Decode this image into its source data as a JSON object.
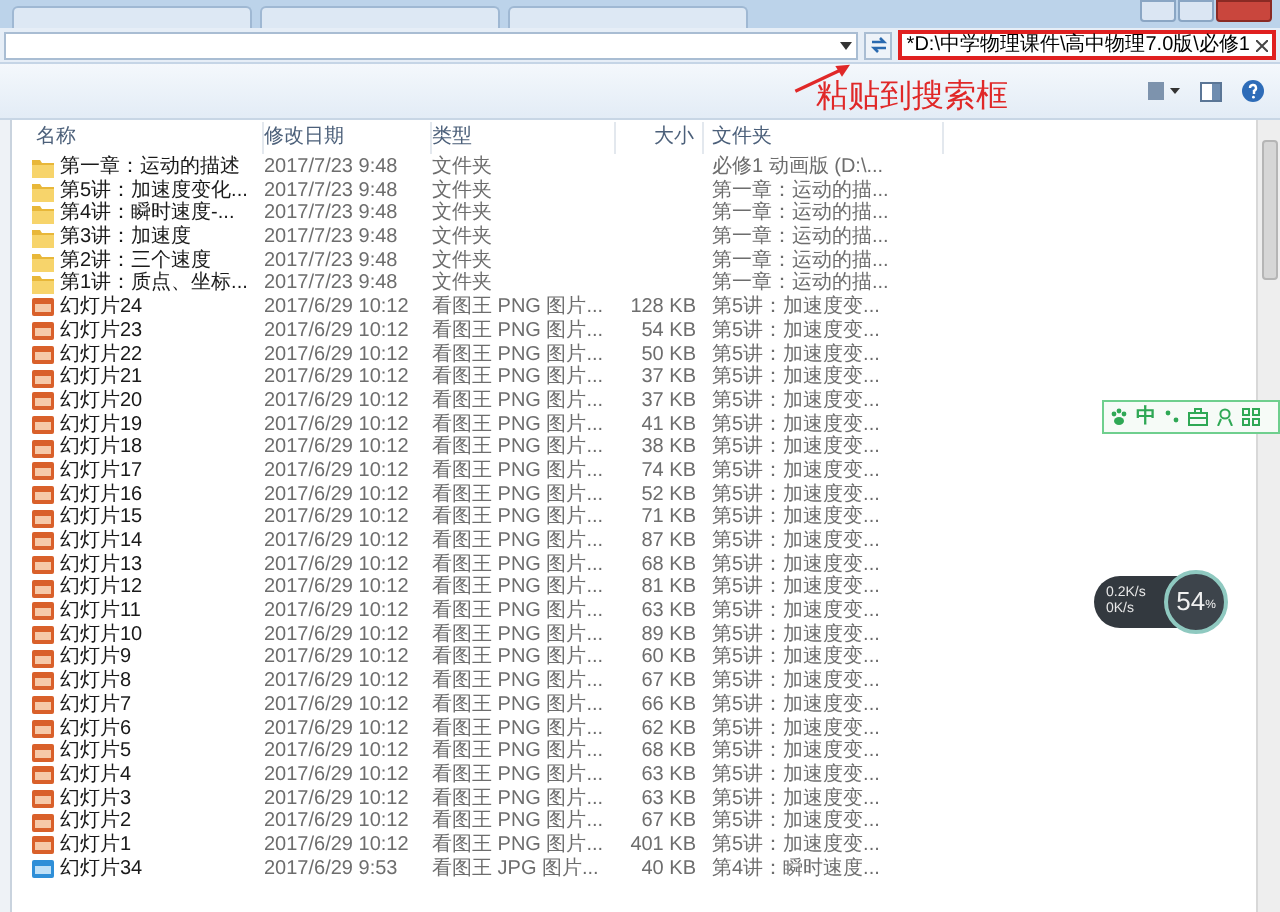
{
  "search": {
    "value": "*D:\\中学物理课件\\高中物理7.0版\\必修1"
  },
  "annotation": {
    "text": "粘贴到搜索框"
  },
  "columns": [
    "名称",
    "修改日期",
    "类型",
    "大小",
    "文件夹"
  ],
  "rows": [
    {
      "kind": "folder",
      "name": "第一章：运动的描述",
      "date": "2017/7/23 9:48",
      "type": "文件夹",
      "size": "",
      "folder": "必修1 动画版 (D:\\..."
    },
    {
      "kind": "folder",
      "name": "第5讲：加速度变化...",
      "date": "2017/7/23 9:48",
      "type": "文件夹",
      "size": "",
      "folder": "第一章：运动的描..."
    },
    {
      "kind": "folder",
      "name": "第4讲：瞬时速度-...",
      "date": "2017/7/23 9:48",
      "type": "文件夹",
      "size": "",
      "folder": "第一章：运动的描..."
    },
    {
      "kind": "folder",
      "name": "第3讲：加速度",
      "date": "2017/7/23 9:48",
      "type": "文件夹",
      "size": "",
      "folder": "第一章：运动的描..."
    },
    {
      "kind": "folder",
      "name": "第2讲：三个速度",
      "date": "2017/7/23 9:48",
      "type": "文件夹",
      "size": "",
      "folder": "第一章：运动的描..."
    },
    {
      "kind": "folder",
      "name": "第1讲：质点、坐标...",
      "date": "2017/7/23 9:48",
      "type": "文件夹",
      "size": "",
      "folder": "第一章：运动的描..."
    },
    {
      "kind": "png",
      "name": "幻灯片24",
      "date": "2017/6/29 10:12",
      "type": "看图王 PNG 图片...",
      "size": "128 KB",
      "folder": "第5讲：加速度变..."
    },
    {
      "kind": "png",
      "name": "幻灯片23",
      "date": "2017/6/29 10:12",
      "type": "看图王 PNG 图片...",
      "size": "54 KB",
      "folder": "第5讲：加速度变..."
    },
    {
      "kind": "png",
      "name": "幻灯片22",
      "date": "2017/6/29 10:12",
      "type": "看图王 PNG 图片...",
      "size": "50 KB",
      "folder": "第5讲：加速度变..."
    },
    {
      "kind": "png",
      "name": "幻灯片21",
      "date": "2017/6/29 10:12",
      "type": "看图王 PNG 图片...",
      "size": "37 KB",
      "folder": "第5讲：加速度变..."
    },
    {
      "kind": "png",
      "name": "幻灯片20",
      "date": "2017/6/29 10:12",
      "type": "看图王 PNG 图片...",
      "size": "37 KB",
      "folder": "第5讲：加速度变..."
    },
    {
      "kind": "png",
      "name": "幻灯片19",
      "date": "2017/6/29 10:12",
      "type": "看图王 PNG 图片...",
      "size": "41 KB",
      "folder": "第5讲：加速度变..."
    },
    {
      "kind": "png",
      "name": "幻灯片18",
      "date": "2017/6/29 10:12",
      "type": "看图王 PNG 图片...",
      "size": "38 KB",
      "folder": "第5讲：加速度变..."
    },
    {
      "kind": "png",
      "name": "幻灯片17",
      "date": "2017/6/29 10:12",
      "type": "看图王 PNG 图片...",
      "size": "74 KB",
      "folder": "第5讲：加速度变..."
    },
    {
      "kind": "png",
      "name": "幻灯片16",
      "date": "2017/6/29 10:12",
      "type": "看图王 PNG 图片...",
      "size": "52 KB",
      "folder": "第5讲：加速度变..."
    },
    {
      "kind": "png",
      "name": "幻灯片15",
      "date": "2017/6/29 10:12",
      "type": "看图王 PNG 图片...",
      "size": "71 KB",
      "folder": "第5讲：加速度变..."
    },
    {
      "kind": "png",
      "name": "幻灯片14",
      "date": "2017/6/29 10:12",
      "type": "看图王 PNG 图片...",
      "size": "87 KB",
      "folder": "第5讲：加速度变..."
    },
    {
      "kind": "png",
      "name": "幻灯片13",
      "date": "2017/6/29 10:12",
      "type": "看图王 PNG 图片...",
      "size": "68 KB",
      "folder": "第5讲：加速度变..."
    },
    {
      "kind": "png",
      "name": "幻灯片12",
      "date": "2017/6/29 10:12",
      "type": "看图王 PNG 图片...",
      "size": "81 KB",
      "folder": "第5讲：加速度变..."
    },
    {
      "kind": "png",
      "name": "幻灯片11",
      "date": "2017/6/29 10:12",
      "type": "看图王 PNG 图片...",
      "size": "63 KB",
      "folder": "第5讲：加速度变..."
    },
    {
      "kind": "png",
      "name": "幻灯片10",
      "date": "2017/6/29 10:12",
      "type": "看图王 PNG 图片...",
      "size": "89 KB",
      "folder": "第5讲：加速度变..."
    },
    {
      "kind": "png",
      "name": "幻灯片9",
      "date": "2017/6/29 10:12",
      "type": "看图王 PNG 图片...",
      "size": "60 KB",
      "folder": "第5讲：加速度变..."
    },
    {
      "kind": "png",
      "name": "幻灯片8",
      "date": "2017/6/29 10:12",
      "type": "看图王 PNG 图片...",
      "size": "67 KB",
      "folder": "第5讲：加速度变..."
    },
    {
      "kind": "png",
      "name": "幻灯片7",
      "date": "2017/6/29 10:12",
      "type": "看图王 PNG 图片...",
      "size": "66 KB",
      "folder": "第5讲：加速度变..."
    },
    {
      "kind": "png",
      "name": "幻灯片6",
      "date": "2017/6/29 10:12",
      "type": "看图王 PNG 图片...",
      "size": "62 KB",
      "folder": "第5讲：加速度变..."
    },
    {
      "kind": "png",
      "name": "幻灯片5",
      "date": "2017/6/29 10:12",
      "type": "看图王 PNG 图片...",
      "size": "68 KB",
      "folder": "第5讲：加速度变..."
    },
    {
      "kind": "png",
      "name": "幻灯片4",
      "date": "2017/6/29 10:12",
      "type": "看图王 PNG 图片...",
      "size": "63 KB",
      "folder": "第5讲：加速度变..."
    },
    {
      "kind": "png",
      "name": "幻灯片3",
      "date": "2017/6/29 10:12",
      "type": "看图王 PNG 图片...",
      "size": "63 KB",
      "folder": "第5讲：加速度变..."
    },
    {
      "kind": "png",
      "name": "幻灯片2",
      "date": "2017/6/29 10:12",
      "type": "看图王 PNG 图片...",
      "size": "67 KB",
      "folder": "第5讲：加速度变..."
    },
    {
      "kind": "png",
      "name": "幻灯片1",
      "date": "2017/6/29 10:12",
      "type": "看图王 PNG 图片...",
      "size": "401 KB",
      "folder": "第5讲：加速度变..."
    },
    {
      "kind": "jpg",
      "name": "幻灯片34",
      "date": "2017/6/29 9:53",
      "type": "看图王 JPG 图片...",
      "size": "40 KB",
      "folder": "第4讲：瞬时速度..."
    }
  ],
  "ime_toolbar": {
    "label": "中"
  },
  "net_meter": {
    "upload": "0.2K/s",
    "download": "0K/s",
    "usage": "54",
    "unit": "%"
  }
}
